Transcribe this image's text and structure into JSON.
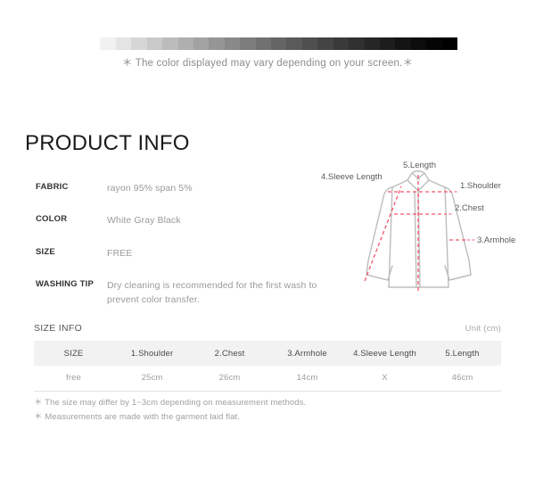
{
  "color_bar": {
    "note": "＊ The color displayed may vary depending on your screen.＊",
    "start_color": "#ffffff",
    "end_color": "#000000",
    "steps": 24
  },
  "product_info": {
    "title": "PRODUCT INFO",
    "rows": [
      {
        "label": "FABRIC",
        "value": "rayon 95% span 5%"
      },
      {
        "label": "COLOR",
        "value": "White Gray Black"
      },
      {
        "label": "SIZE",
        "value": "FREE"
      },
      {
        "label": "WASHING TIP",
        "value": "Dry cleaning is recommended for the first wash to prevent color transfer."
      }
    ]
  },
  "diagram": {
    "labels": {
      "shoulder": "1.Shoulder",
      "chest": "2.Chest",
      "armhole": "3.Armhole",
      "sleeve_length": "4.Sleeve Length",
      "length": "5.Length"
    },
    "outline_color": "#bdbdbd",
    "measure_color": "#f4536b"
  },
  "size_info": {
    "label": "SIZE INFO",
    "unit": "Unit (cm)",
    "columns": [
      "SIZE",
      "1.Shoulder",
      "2.Chest",
      "3.Armhole",
      "4.Sleeve Length",
      "5.Length"
    ],
    "rows": [
      [
        "free",
        "25cm",
        "26cm",
        "14cm",
        "X",
        "46cm"
      ]
    ],
    "notes": [
      "＊ The size may differ by 1~3cm depending on measurement methods.",
      "＊ Measurements are made with the garment laid flat."
    ]
  }
}
